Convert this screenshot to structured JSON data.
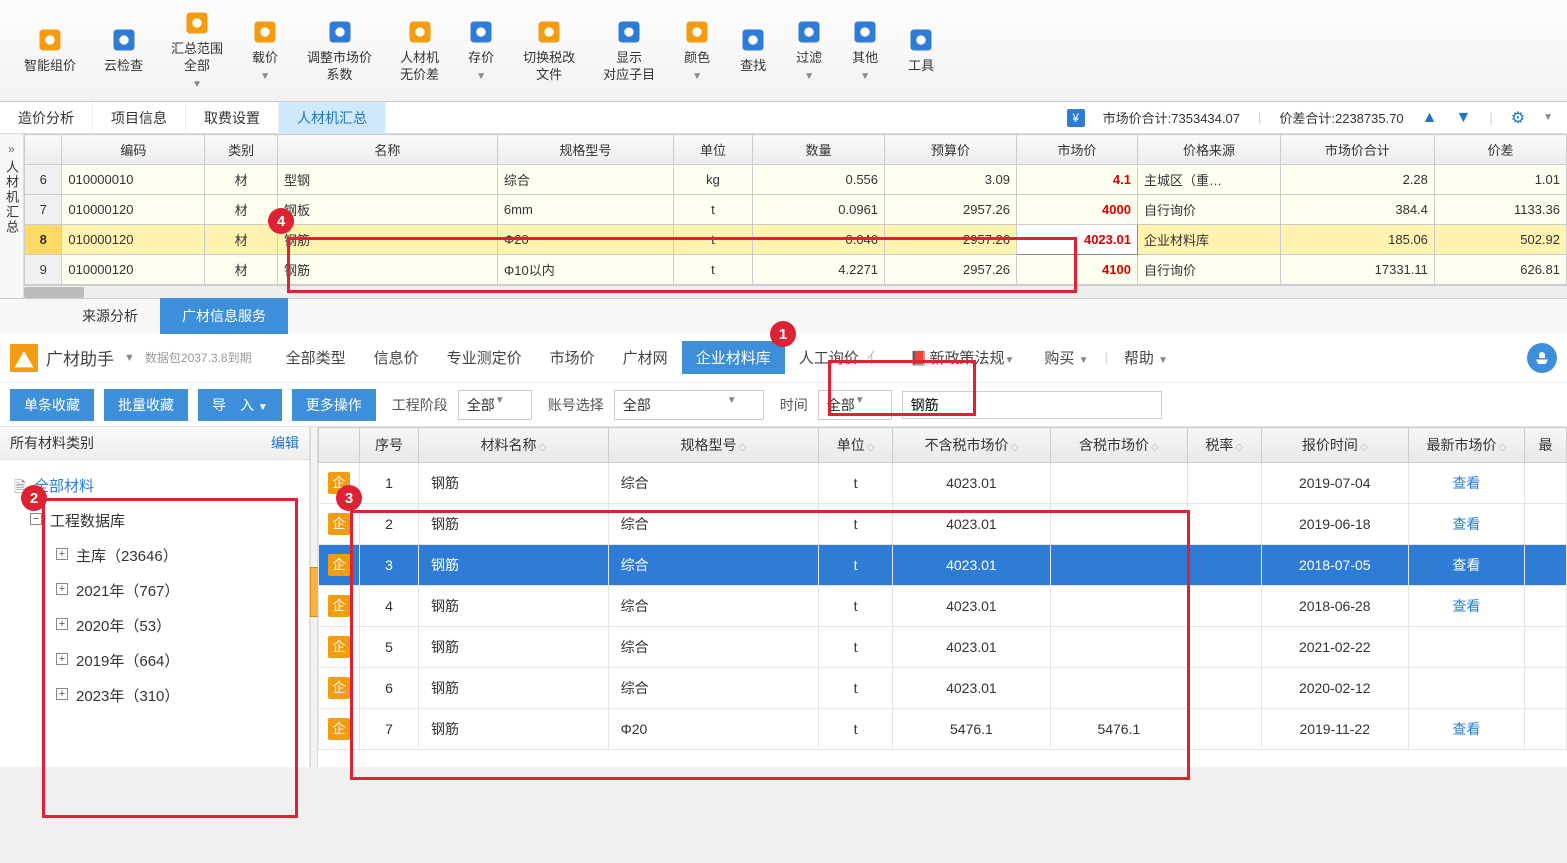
{
  "toolbar": [
    {
      "label": "智能组价",
      "icon": "#f39c12"
    },
    {
      "label": "云检查",
      "icon": "#2e7cd6"
    },
    {
      "label": "汇总范围\n全部",
      "icon": "#f39c12"
    },
    {
      "label": "载价",
      "icon": "#f39c12"
    },
    {
      "label": "调整市场价\n系数",
      "icon": "#2e7cd6"
    },
    {
      "label": "人材机\n无价差",
      "icon": "#f39c12"
    },
    {
      "label": "存价",
      "icon": "#2e7cd6"
    },
    {
      "label": "切换税改\n文件",
      "icon": "#f39c12"
    },
    {
      "label": "显示\n对应子目",
      "icon": "#2e7cd6"
    },
    {
      "label": "颜色",
      "icon": "#f39c12"
    },
    {
      "label": "查找",
      "icon": "#2e7cd6"
    },
    {
      "label": "过滤",
      "icon": "#2e7cd6"
    },
    {
      "label": "其他",
      "icon": "#2e7cd6"
    },
    {
      "label": "工具",
      "icon": "#2e7cd6"
    }
  ],
  "subtabs": [
    "造价分析",
    "项目信息",
    "取费设置",
    "人材机汇总"
  ],
  "subtab_active": 3,
  "summary": {
    "market_total_label": "市场价合计:",
    "market_total_value": "7353434.07",
    "diff_label": "价差合计:",
    "diff_value": "2238735.70"
  },
  "side_label": "人材机汇总",
  "grid_headers": [
    "",
    "编码",
    "类别",
    "名称",
    "规格型号",
    "单位",
    "数量",
    "预算价",
    "市场价",
    "价格来源",
    "市场价合计",
    "价差"
  ],
  "grid_rows": [
    {
      "n": "6",
      "code": "010000010",
      "cat": "材",
      "name": "型钢",
      "spec": "综合",
      "unit": "kg",
      "qty": "0.556",
      "budget": "3.09",
      "market": "4.1",
      "src": "主城区（重…",
      "mtot": "2.28",
      "diff": "1.01",
      "sel": false
    },
    {
      "n": "7",
      "code": "010000120",
      "cat": "材",
      "name": "钢板",
      "spec": "6mm",
      "unit": "t",
      "qty": "0.0961",
      "budget": "2957.26",
      "market": "4000",
      "src": "自行询价",
      "mtot": "384.4",
      "diff": "1133.36",
      "sel": false
    },
    {
      "n": "8",
      "code": "010000120",
      "cat": "材",
      "name": "钢筋",
      "spec": "Φ20",
      "unit": "t",
      "qty": "0.046",
      "budget": "2957.26",
      "market": "4023.01",
      "src": "企业材料库",
      "mtot": "185.06",
      "diff": "502.92",
      "sel": true
    },
    {
      "n": "9",
      "code": "010000120",
      "cat": "材",
      "name": "钢筋",
      "spec": "Φ10以内",
      "unit": "t",
      "qty": "4.2271",
      "budget": "2957.26",
      "market": "4100",
      "src": "自行询价",
      "mtot": "17331.11",
      "diff": "626.81",
      "sel": false
    }
  ],
  "btabs": [
    "来源分析",
    "广材信息服务"
  ],
  "btab_active": 1,
  "gc": {
    "title": "广材助手",
    "expire": "数据包2037.3.8到期",
    "types": [
      "全部类型",
      "信息价",
      "专业测定价",
      "市场价",
      "广材网",
      "企业材料库",
      "人工询价",
      "新政策法规"
    ],
    "type_active": 5,
    "buy": "购买",
    "help": "帮助"
  },
  "actions": {
    "single": "单条收藏",
    "batch": "批量收藏",
    "import": "导　入",
    "more": "更多操作",
    "stage_lbl": "工程阶段",
    "stage_val": "全部",
    "acct_lbl": "账号选择",
    "acct_val": "全部",
    "time_lbl": "时间",
    "time_val": "全部",
    "search_val": "钢筋"
  },
  "tree": {
    "header": "所有材料类别",
    "edit": "编辑",
    "items": [
      {
        "lv": 0,
        "type": "doc",
        "label": "全部材料",
        "all": true
      },
      {
        "lv": 1,
        "type": "minus",
        "label": "工程数据库"
      },
      {
        "lv": 2,
        "type": "plus",
        "label": "主库（23646）"
      },
      {
        "lv": 2,
        "type": "plus",
        "label": "2021年（767）"
      },
      {
        "lv": 2,
        "type": "plus",
        "label": "2020年（53）"
      },
      {
        "lv": 2,
        "type": "plus",
        "label": "2019年（664）"
      },
      {
        "lv": 2,
        "type": "plus",
        "label": "2023年（310）"
      }
    ]
  },
  "rheaders": [
    "",
    "序号",
    "材料名称",
    "规格型号",
    "单位",
    "不含税市场价",
    "含税市场价",
    "税率",
    "报价时间",
    "最新市场价",
    "最"
  ],
  "rrows": [
    {
      "n": "1",
      "name": "钢筋",
      "spec": "综合",
      "unit": "t",
      "p1": "4023.01",
      "p2": "",
      "date": "2019-07-04",
      "view": "查看",
      "sel": false
    },
    {
      "n": "2",
      "name": "钢筋",
      "spec": "综合",
      "unit": "t",
      "p1": "4023.01",
      "p2": "",
      "date": "2019-06-18",
      "view": "查看",
      "sel": false
    },
    {
      "n": "3",
      "name": "钢筋",
      "spec": "综合",
      "unit": "t",
      "p1": "4023.01",
      "p2": "",
      "date": "2018-07-05",
      "view": "查看",
      "sel": true
    },
    {
      "n": "4",
      "name": "钢筋",
      "spec": "综合",
      "unit": "t",
      "p1": "4023.01",
      "p2": "",
      "date": "2018-06-28",
      "view": "查看",
      "sel": false
    },
    {
      "n": "5",
      "name": "钢筋",
      "spec": "综合",
      "unit": "t",
      "p1": "4023.01",
      "p2": "",
      "date": "2021-02-22",
      "view": "",
      "sel": false
    },
    {
      "n": "6",
      "name": "钢筋",
      "spec": "综合",
      "unit": "t",
      "p1": "4023.01",
      "p2": "",
      "date": "2020-02-12",
      "view": "",
      "sel": false
    },
    {
      "n": "7",
      "name": "钢筋",
      "spec": "Φ20",
      "unit": "t",
      "p1": "5476.1",
      "p2": "5476.1",
      "date": "2019-11-22",
      "view": "查看",
      "sel": false
    }
  ],
  "badge": "企",
  "annotations": [
    "1",
    "2",
    "3",
    "4"
  ]
}
